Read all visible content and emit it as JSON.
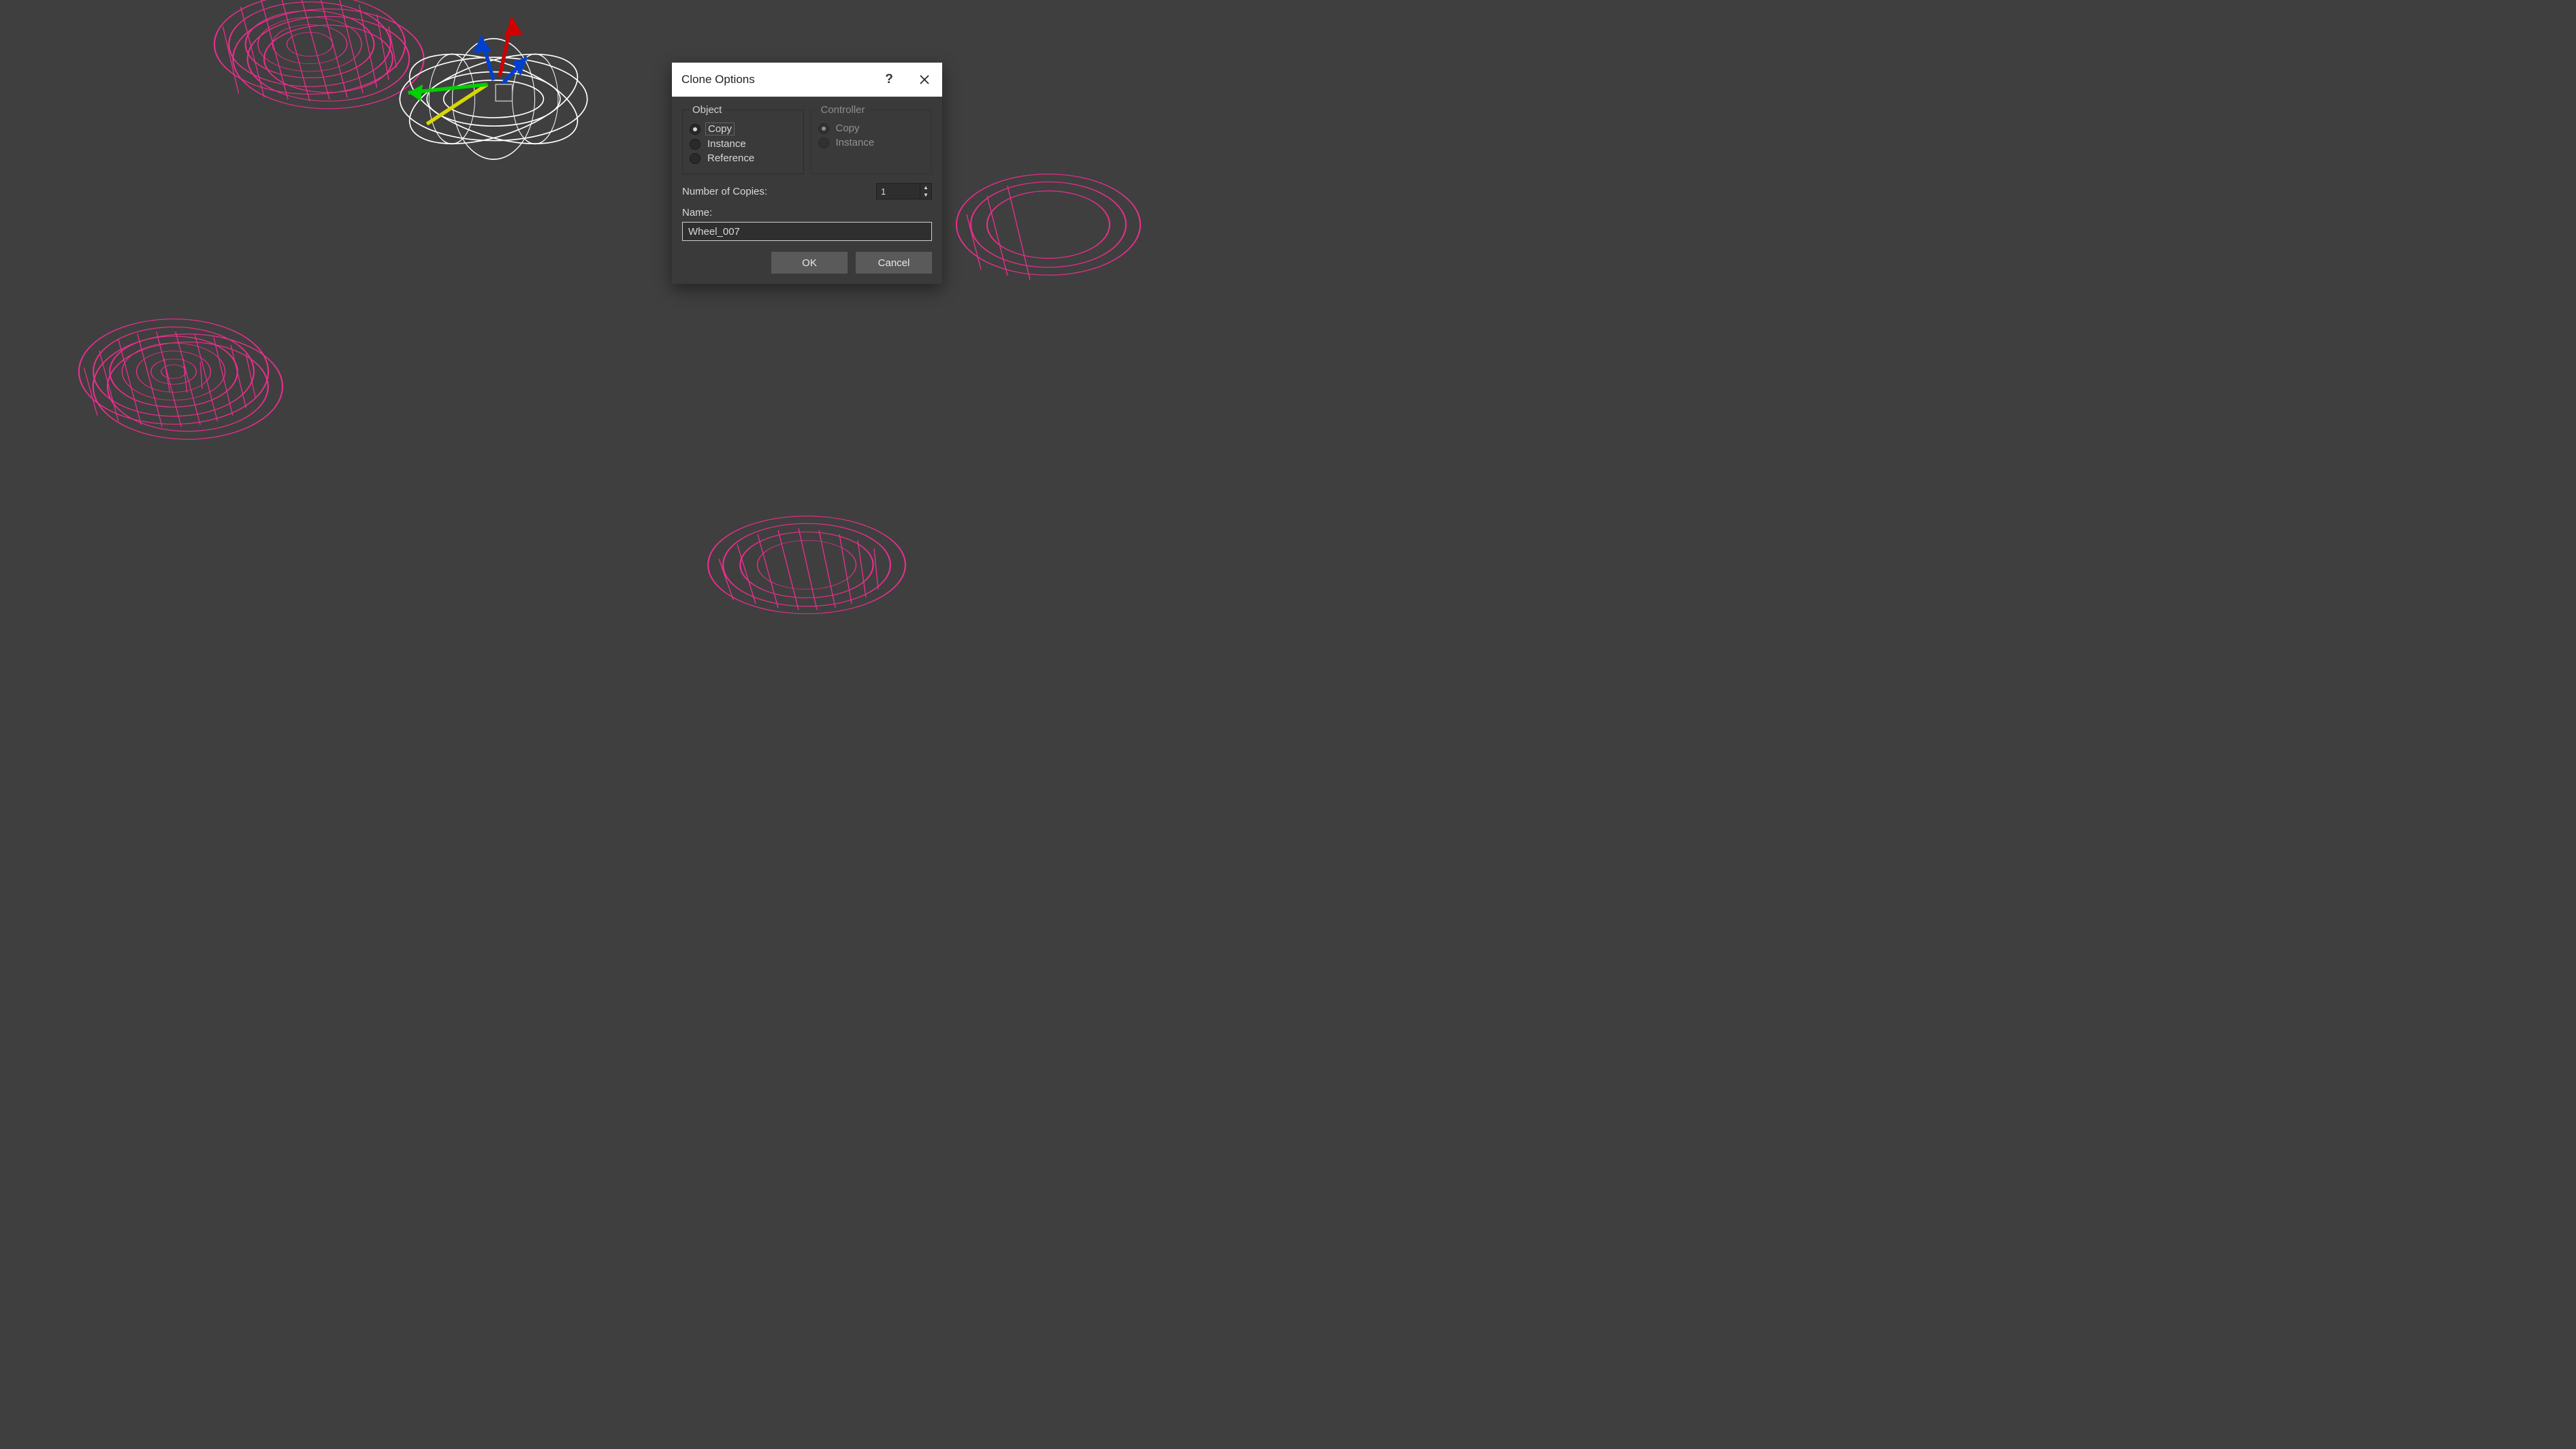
{
  "dialog": {
    "title": "Clone Options",
    "object_group": {
      "legend": "Object",
      "copy": "Copy",
      "instance": "Instance",
      "reference": "Reference",
      "selected": "copy"
    },
    "controller_group": {
      "legend": "Controller",
      "copy": "Copy",
      "instance": "Instance",
      "enabled": false
    },
    "copies_label": "Number of Copies:",
    "copies_value": "1",
    "name_label": "Name:",
    "name_value": "Wheel_007",
    "ok": "OK",
    "cancel": "Cancel"
  }
}
